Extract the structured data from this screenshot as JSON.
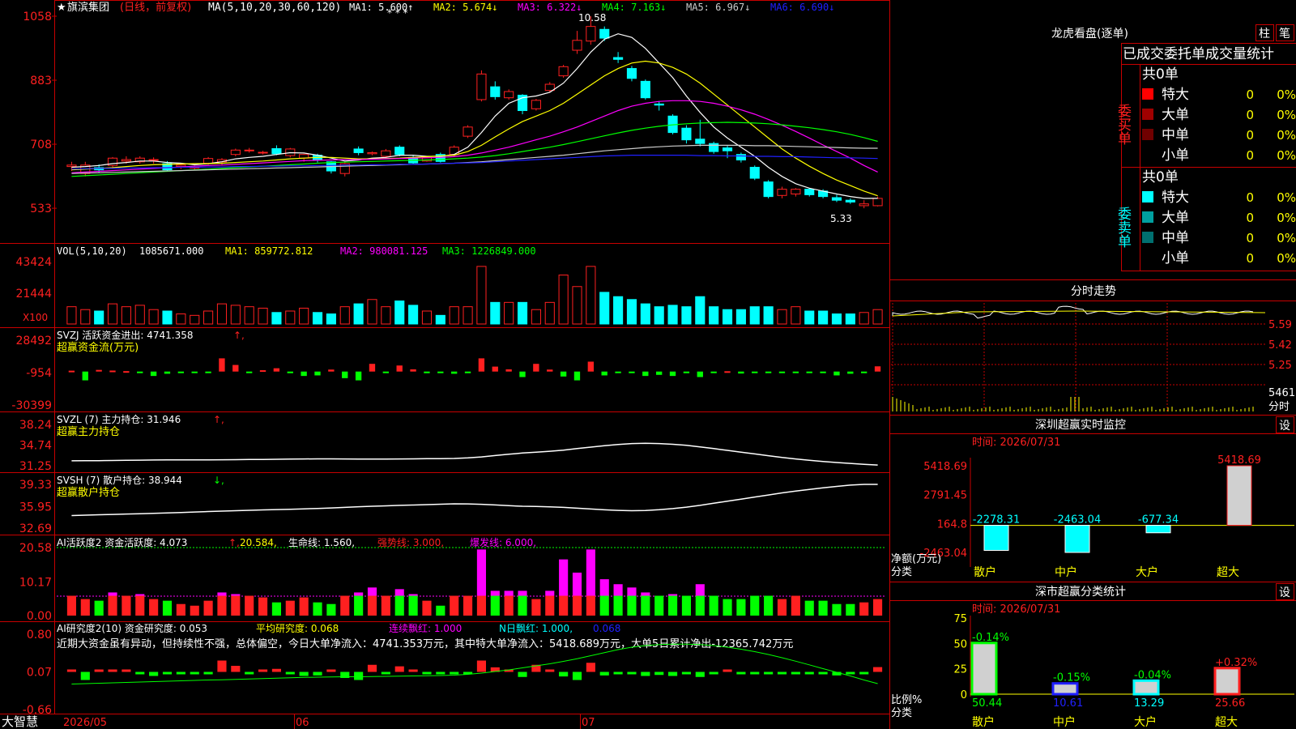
{
  "colors": {
    "up": "#ff2020",
    "down": "#00ffff",
    "vol_down": "#00ffff",
    "green": "#00ff00",
    "magenta": "#ff00ff",
    "yellow": "#ffff00",
    "white": "#ffffff",
    "red_frame": "#c80000",
    "ma1": "#ffffff",
    "ma2": "#ffff00",
    "ma3": "#ff00ff",
    "ma4": "#00ff00",
    "ma5": "#cccccc",
    "ma6": "#2020ff"
  },
  "main": {
    "title": "旗滨集团",
    "subtitle": "(日线，前复权)",
    "ma_params": "MA(5,10,20,30,60,120)",
    "ma_values": [
      {
        "label": "MA1:",
        "value": "5.600",
        "arrow": "↑",
        "color": "#ffffff"
      },
      {
        "label": "MA2:",
        "value": "5.674",
        "arrow": "↓",
        "color": "#ffff00"
      },
      {
        "label": "MA3:",
        "value": "6.322",
        "arrow": "↓",
        "color": "#ff00ff"
      },
      {
        "label": "MA4:",
        "value": "7.163",
        "arrow": "↓",
        "color": "#00ff00"
      },
      {
        "label": "MA5:",
        "value": "6.967",
        "arrow": "↓",
        "color": "#cccccc"
      },
      {
        "label": "MA6:",
        "value": "6.690",
        "arrow": "↓",
        "color": "#2020ff"
      }
    ],
    "ticks": [
      "1058",
      "883",
      "708",
      "533"
    ],
    "high_label": "10.58",
    "low_label": "5.33"
  },
  "vol": {
    "header": "VOL(5,10,20)",
    "value": "1085671.000",
    "ma1": "MA1: 859772.812",
    "ma2": "MA2: 980081.125",
    "ma3": "MA3: 1226849.000",
    "ticks": [
      "43424",
      "21444"
    ],
    "unit": "X100"
  },
  "svzj": {
    "header": "SVZJ  活跃资金进出: 4741.358",
    "arrow": "↑,",
    "sub": "超赢资金流(万元)",
    "ticks": [
      "28492",
      "-954",
      "-30399"
    ]
  },
  "svzl": {
    "header": "SVZL (7) 主力持仓: 31.946",
    "arrow": "↑,",
    "sub": "超赢主力持仓",
    "ticks": [
      "38.24",
      "34.74",
      "31.25"
    ]
  },
  "svsh": {
    "header": "SVSH (7) 散户持仓: 38.944",
    "arrow": "↓,",
    "sub": "超赢散户持仓",
    "ticks": [
      "39.33",
      "35.95",
      "32.69"
    ]
  },
  "ai2": {
    "header": "AI活跃度2 资金活跃度: 4.073",
    "h2": "20.584,",
    "h3": "生命线: 1.560,",
    "h4": "强势线: 3.000,",
    "h5": "爆发线: 6.000,",
    "ticks": [
      "20.58",
      "10.17",
      "0.00"
    ]
  },
  "ai_study": {
    "header": "AI研究度2(10) 资金研究度: 0.053",
    "h2": "平均研究度: 0.068",
    "h3": "连续飘红: 1.000",
    "h4": "N日飘红: 1.000,",
    "h5": "0.068",
    "comment": "近期大资金虽有异动，但持续性不强，总体偏空，今日大单净流入：4741.353万元，其中特大单净流入：5418.689万元，大单5日累计净出-12365.742万元",
    "ticks": [
      "0.80",
      "0.07",
      "-0.66"
    ]
  },
  "xaxis": {
    "labels": [
      "2026/05",
      "06",
      "07"
    ],
    "brand": "大智慧"
  },
  "right": {
    "dragon_title": "龙虎看盘(逐单)",
    "btn1": "柱",
    "btn2": "笔",
    "order_title": "已成交委托单成交量统计",
    "buy_label": "委买单",
    "sell_label": "委卖单",
    "buy_total": "共0单",
    "sell_total": "共0单",
    "rows": [
      {
        "name": "特大",
        "count": "0",
        "pct": "0%"
      },
      {
        "name": "大单",
        "count": "0",
        "pct": "0%"
      },
      {
        "name": "中单",
        "count": "0",
        "pct": "0%"
      },
      {
        "name": "小单",
        "count": "0",
        "pct": "0%"
      }
    ],
    "intraday_title": "分时走势",
    "intraday_ticks": [
      "5.59",
      "5.42",
      "5.25"
    ],
    "intraday_vol": "5461",
    "intraday_label": "分时",
    "monitor_title": "深圳超赢实时监控",
    "monitor_btn": "设",
    "monitor_time": "时间: 2026/07/31",
    "monitor_ticks": [
      "5418.69",
      "2791.45",
      "164.8",
      "-2463.04"
    ],
    "monitor_ylabel": "净额(万元)",
    "monitor_xlabel": "分类",
    "categories": [
      "散户",
      "中户",
      "大户",
      "超大"
    ],
    "monitor_values": [
      -2278.31,
      -2463.04,
      -677.34,
      5418.69
    ],
    "monitor_value_labels": [
      "-2278.31",
      "-2463.04",
      "-677.34",
      "5418.69"
    ],
    "stat_title": "深市超赢分类统计",
    "stat_btn": "设",
    "stat_time": "时间: 2026/07/31",
    "stat_ticks": [
      "75",
      "50",
      "25",
      "0"
    ],
    "stat_values": [
      50.44,
      10.61,
      13.29,
      25.66
    ],
    "stat_value_labels": [
      "50.44",
      "10.61",
      "13.29",
      "25.66"
    ],
    "stat_pct_labels": [
      "-0.14%",
      "-0.15%",
      "-0.04%",
      "+0.32%"
    ],
    "stat_ylabel": "比例%",
    "stat_xlabel": "分类"
  },
  "chart_data": {
    "type": "candlestick",
    "title": "旗滨集团 (日线，前复权)",
    "ylim": [
      5.33,
      10.58
    ],
    "x": [
      "2026/05",
      "06",
      "07"
    ],
    "candles": [
      [
        6.47,
        6.51,
        6.6,
        6.35
      ],
      [
        6.28,
        6.51,
        6.6,
        6.2
      ],
      [
        6.44,
        6.38,
        6.53,
        6.3
      ],
      [
        6.5,
        6.7,
        6.73,
        6.45
      ],
      [
        6.62,
        6.66,
        6.75,
        6.55
      ],
      [
        6.6,
        6.7,
        6.75,
        6.55
      ],
      [
        6.64,
        6.66,
        6.72,
        6.55
      ],
      [
        6.55,
        6.38,
        6.62,
        6.33
      ],
      [
        6.47,
        6.51,
        6.55,
        6.4
      ],
      [
        6.44,
        6.45,
        6.5,
        6.38
      ],
      [
        6.56,
        6.69,
        6.73,
        6.52
      ],
      [
        6.6,
        6.66,
        6.7,
        6.5
      ],
      [
        6.8,
        6.92,
        6.96,
        6.75
      ],
      [
        6.9,
        6.92,
        6.98,
        6.85
      ],
      [
        6.84,
        6.86,
        6.9,
        6.8
      ],
      [
        6.96,
        6.82,
        7.05,
        6.78
      ],
      [
        6.77,
        6.95,
        6.98,
        6.72
      ],
      [
        6.7,
        6.8,
        6.82,
        6.6
      ],
      [
        6.78,
        6.65,
        6.82,
        6.58
      ],
      [
        6.6,
        6.35,
        6.62,
        6.28
      ],
      [
        6.28,
        6.55,
        6.6,
        6.2
      ],
      [
        6.95,
        6.85,
        7.02,
        6.78
      ],
      [
        6.82,
        6.85,
        6.88,
        6.78
      ],
      [
        6.75,
        6.9,
        6.95,
        6.7
      ],
      [
        7.0,
        6.8,
        7.05,
        6.75
      ],
      [
        6.72,
        6.57,
        6.78,
        6.55
      ],
      [
        6.62,
        6.72,
        6.76,
        6.6
      ],
      [
        6.8,
        6.61,
        6.85,
        6.58
      ],
      [
        6.8,
        7.0,
        7.05,
        6.75
      ],
      [
        7.3,
        7.55,
        7.6,
        7.25
      ],
      [
        8.3,
        9.0,
        9.1,
        8.25
      ],
      [
        8.65,
        8.38,
        8.8,
        8.3
      ],
      [
        8.35,
        8.52,
        8.58,
        8.3
      ],
      [
        8.42,
        8.0,
        8.45,
        7.9
      ],
      [
        8.05,
        8.28,
        8.32,
        8.0
      ],
      [
        8.55,
        8.72,
        8.78,
        8.5
      ],
      [
        8.95,
        9.2,
        9.25,
        8.9
      ],
      [
        9.65,
        9.92,
        10.18,
        9.55
      ],
      [
        9.9,
        10.3,
        10.58,
        9.8
      ],
      [
        10.22,
        9.98,
        10.3,
        9.9
      ],
      [
        9.45,
        9.4,
        9.6,
        9.3
      ],
      [
        9.15,
        8.88,
        9.22,
        8.8
      ],
      [
        8.8,
        8.35,
        8.85,
        8.3
      ],
      [
        8.18,
        8.15,
        8.25,
        8.0
      ],
      [
        7.85,
        7.4,
        7.9,
        7.35
      ],
      [
        7.52,
        7.2,
        7.6,
        7.1
      ],
      [
        7.22,
        7.1,
        7.75,
        7.02
      ],
      [
        7.1,
        6.88,
        7.15,
        6.82
      ],
      [
        6.98,
        6.9,
        7.05,
        6.7
      ],
      [
        6.8,
        6.65,
        6.85,
        6.58
      ],
      [
        6.45,
        6.15,
        6.5,
        6.1
      ],
      [
        6.05,
        5.65,
        6.1,
        5.6
      ],
      [
        5.68,
        5.85,
        5.92,
        5.6
      ],
      [
        5.72,
        5.85,
        5.88,
        5.65
      ],
      [
        5.85,
        5.7,
        5.88,
        5.65
      ],
      [
        5.8,
        5.65,
        5.85,
        5.6
      ],
      [
        5.62,
        5.55,
        5.7,
        5.5
      ],
      [
        5.55,
        5.5,
        5.6,
        5.45
      ],
      [
        5.4,
        5.45,
        5.55,
        5.33
      ],
      [
        5.4,
        5.6,
        5.65,
        5.38
      ]
    ],
    "series": [
      {
        "name": "MA1",
        "color": "#ffffff",
        "values": [
          6.45,
          6.47,
          6.5,
          6.55,
          6.58,
          6.62,
          6.62,
          6.58,
          6.56,
          6.52,
          6.55,
          6.6,
          6.68,
          6.72,
          6.75,
          6.8,
          6.85,
          6.84,
          6.78,
          6.7,
          6.62,
          6.65,
          6.7,
          6.72,
          6.78,
          6.78,
          6.75,
          6.75,
          6.8,
          7.0,
          7.4,
          7.85,
          8.2,
          8.35,
          8.4,
          8.5,
          8.75,
          9.15,
          9.6,
          9.95,
          10.1,
          10.0,
          9.7,
          9.3,
          8.9,
          8.4,
          7.95,
          7.55,
          7.25,
          7.0,
          6.75,
          6.45,
          6.2,
          6.0,
          5.88,
          5.8,
          5.72,
          5.65,
          5.6,
          5.6
        ]
      },
      {
        "name": "MA2",
        "color": "#ffff00",
        "values": [
          6.38,
          6.4,
          6.42,
          6.44,
          6.47,
          6.5,
          6.52,
          6.53,
          6.54,
          6.55,
          6.55,
          6.56,
          6.58,
          6.6,
          6.62,
          6.65,
          6.68,
          6.7,
          6.72,
          6.72,
          6.7,
          6.68,
          6.68,
          6.69,
          6.7,
          6.72,
          6.74,
          6.76,
          6.78,
          6.88,
          7.05,
          7.28,
          7.5,
          7.7,
          7.85,
          8.0,
          8.2,
          8.45,
          8.7,
          8.95,
          9.15,
          9.3,
          9.35,
          9.3,
          9.18,
          9.0,
          8.75,
          8.45,
          8.15,
          7.85,
          7.55,
          7.25,
          6.95,
          6.7,
          6.48,
          6.28,
          6.1,
          5.95,
          5.8,
          5.67
        ]
      },
      {
        "name": "MA3",
        "color": "#ff00ff",
        "values": [
          6.3,
          6.32,
          6.34,
          6.36,
          6.38,
          6.4,
          6.42,
          6.44,
          6.46,
          6.48,
          6.5,
          6.51,
          6.53,
          6.55,
          6.57,
          6.59,
          6.61,
          6.63,
          6.64,
          6.65,
          6.66,
          6.66,
          6.67,
          6.68,
          6.69,
          6.7,
          6.71,
          6.72,
          6.74,
          6.78,
          6.84,
          6.92,
          7.0,
          7.1,
          7.2,
          7.3,
          7.42,
          7.55,
          7.7,
          7.85,
          8.0,
          8.12,
          8.2,
          8.25,
          8.27,
          8.27,
          8.25,
          8.2,
          8.12,
          8.02,
          7.9,
          7.76,
          7.6,
          7.43,
          7.25,
          7.06,
          6.88,
          6.7,
          6.5,
          6.32
        ]
      },
      {
        "name": "MA4",
        "color": "#00ff00",
        "values": [
          6.2,
          6.22,
          6.24,
          6.26,
          6.28,
          6.3,
          6.32,
          6.34,
          6.36,
          6.38,
          6.4,
          6.42,
          6.44,
          6.46,
          6.48,
          6.5,
          6.52,
          6.54,
          6.56,
          6.58,
          6.59,
          6.6,
          6.61,
          6.62,
          6.63,
          6.64,
          6.65,
          6.66,
          6.68,
          6.7,
          6.73,
          6.77,
          6.82,
          6.88,
          6.94,
          7.0,
          7.07,
          7.15,
          7.23,
          7.31,
          7.39,
          7.46,
          7.52,
          7.57,
          7.61,
          7.64,
          7.66,
          7.67,
          7.68,
          7.67,
          7.66,
          7.64,
          7.61,
          7.57,
          7.53,
          7.48,
          7.42,
          7.35,
          7.26,
          7.16
        ]
      },
      {
        "name": "MA5",
        "color": "#cccccc",
        "values": [
          6.28,
          6.29,
          6.3,
          6.31,
          6.32,
          6.33,
          6.34,
          6.35,
          6.36,
          6.37,
          6.38,
          6.39,
          6.4,
          6.41,
          6.42,
          6.43,
          6.44,
          6.45,
          6.46,
          6.47,
          6.48,
          6.49,
          6.5,
          6.51,
          6.52,
          6.53,
          6.54,
          6.55,
          6.56,
          6.58,
          6.6,
          6.63,
          6.66,
          6.69,
          6.72,
          6.75,
          6.78,
          6.82,
          6.86,
          6.9,
          6.93,
          6.96,
          6.99,
          7.01,
          7.03,
          7.04,
          7.05,
          7.05,
          7.05,
          7.05,
          7.04,
          7.04,
          7.03,
          7.02,
          7.01,
          7.0,
          6.99,
          6.98,
          6.97,
          6.97
        ]
      },
      {
        "name": "MA6",
        "color": "#2020ff",
        "values": [
          6.4,
          6.41,
          6.42,
          6.42,
          6.43,
          6.43,
          6.44,
          6.44,
          6.45,
          6.45,
          6.46,
          6.46,
          6.47,
          6.47,
          6.48,
          6.48,
          6.49,
          6.49,
          6.5,
          6.5,
          6.51,
          6.51,
          6.52,
          6.52,
          6.53,
          6.53,
          6.54,
          6.55,
          6.56,
          6.57,
          6.58,
          6.6,
          6.62,
          6.64,
          6.66,
          6.68,
          6.7,
          6.72,
          6.74,
          6.76,
          6.77,
          6.78,
          6.78,
          6.78,
          6.78,
          6.78,
          6.77,
          6.77,
          6.76,
          6.76,
          6.75,
          6.75,
          6.74,
          6.74,
          6.73,
          6.72,
          6.71,
          6.71,
          6.7,
          6.69
        ]
      }
    ],
    "volume": [
      12000,
      10000,
      9000,
      14000,
      12000,
      13000,
      10000,
      9000,
      7000,
      6000,
      9000,
      14000,
      13000,
      12000,
      11000,
      8000,
      9000,
      11000,
      8000,
      7000,
      12000,
      14000,
      17000,
      12000,
      16000,
      13000,
      9000,
      6000,
      12000,
      12000,
      40000,
      15000,
      15000,
      15000,
      10000,
      15000,
      34000,
      26000,
      40000,
      22000,
      19000,
      17000,
      14000,
      12000,
      13000,
      12000,
      19000,
      12000,
      10000,
      10000,
      12000,
      12000,
      10000,
      12000,
      9000,
      9000,
      7000,
      7000,
      8000,
      10000
    ],
    "fund_flow": [
      800,
      -8000,
      1500,
      900,
      400,
      -300,
      -4000,
      -2000,
      -1000,
      -300,
      -1000,
      12000,
      6000,
      -900,
      1200,
      3000,
      -1500,
      -4000,
      -3500,
      1800,
      -6000,
      -8000,
      7000,
      -900,
      5500,
      2000,
      -1500,
      -900,
      -2000,
      -1500,
      12000,
      4500,
      2000,
      -5000,
      7000,
      1800,
      -4500,
      -8000,
      9000,
      -3500,
      -500,
      -1200,
      -4000,
      -3000,
      -4000,
      -1500,
      -5000,
      -1100,
      300,
      -1800,
      -800,
      -1000,
      -1200,
      -900,
      -1100,
      -1200,
      -3500,
      -2000,
      -1500,
      4741
    ]
  }
}
